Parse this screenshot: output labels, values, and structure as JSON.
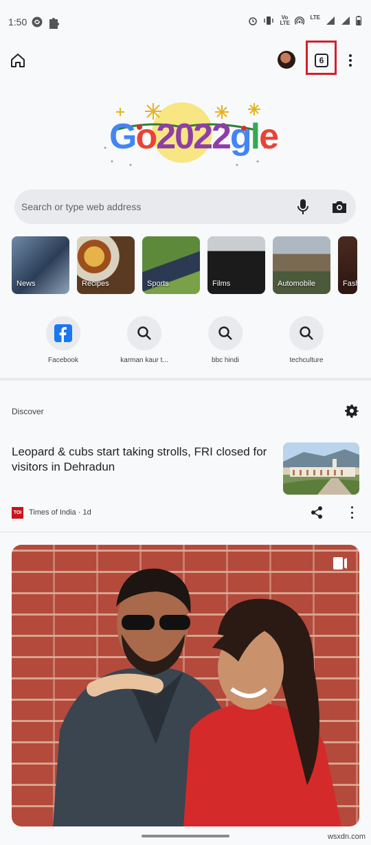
{
  "status": {
    "time": "1:50",
    "network": "LTE",
    "volte": "Vo LTE"
  },
  "toolbar": {
    "tab_count": "6"
  },
  "doodle": {
    "alt": "Google 2022 doodle",
    "letters": [
      "G",
      "o",
      "2",
      "0",
      "2",
      "2",
      "g",
      "l",
      "e"
    ]
  },
  "search": {
    "placeholder": "Search or type web address"
  },
  "topics": [
    {
      "label": "News"
    },
    {
      "label": "Recipes"
    },
    {
      "label": "Sports"
    },
    {
      "label": "Films"
    },
    {
      "label": "Automobile"
    },
    {
      "label": "Fash"
    }
  ],
  "shortcuts": [
    {
      "label": "Facebook"
    },
    {
      "label": "karman kaur t..."
    },
    {
      "label": "bbc hindi"
    },
    {
      "label": "techculture"
    }
  ],
  "discover": {
    "label": "Discover",
    "article": {
      "title": "Leopard & cubs start taking strolls, FRI closed for visitors in Dehradun",
      "source_logo": "TOI",
      "source": "Times of India · 1d"
    }
  },
  "watermark": "wsxdn.com",
  "colors": {
    "tab_highlight": "#d41f2a",
    "facebook": "#1877f2",
    "toi": "#c7141d"
  }
}
